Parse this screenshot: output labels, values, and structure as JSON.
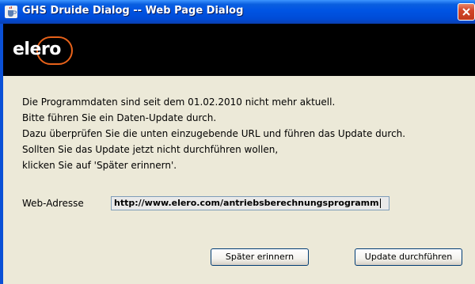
{
  "window": {
    "title": "GHS Druide Dialog -- Web Page Dialog",
    "title_icon": "java-cup-icon",
    "close_icon": "close-icon"
  },
  "banner": {
    "logo_text": "elero",
    "logo_ring_color": "#e8621a"
  },
  "message": {
    "line1": "Die Programmdaten sind seit dem 01.02.2010 nicht mehr aktuell.",
    "line2": "Bitte führen Sie ein Daten-Update durch.",
    "line3": "Dazu überprüfen Sie die unten einzugebende URL und führen das Update durch.",
    "line4": "Sollten Sie das Update jetzt nicht durchführen wollen,",
    "line5": "klicken Sie auf 'Später erinnern'."
  },
  "form": {
    "url_label": "Web-Adresse",
    "url_value": "http://www.elero.com/antriebsberechnungsprogramm"
  },
  "buttons": {
    "later_label": "Später erinnern",
    "update_label": "Update durchführen"
  }
}
